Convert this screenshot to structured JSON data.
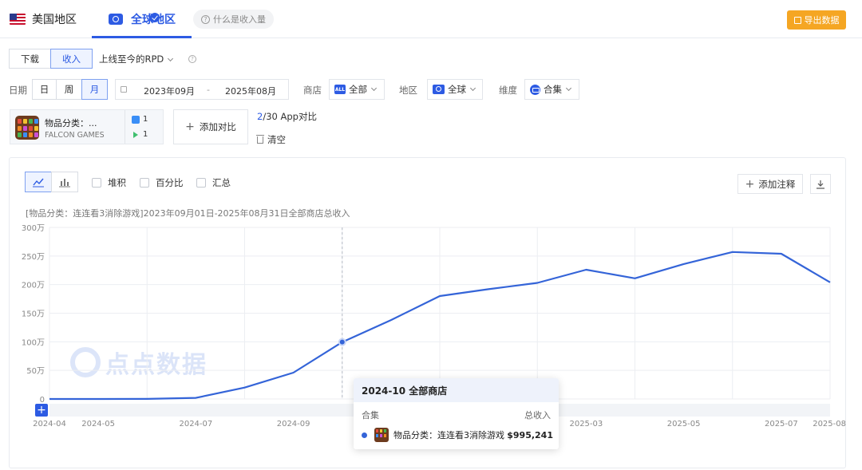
{
  "tabs": {
    "us": "美国地区",
    "global": "全球地区",
    "what_is_revenue": "什么是收入量"
  },
  "export_label": "导出数据",
  "metric": {
    "download": "下载",
    "revenue": "收入",
    "rpd": "上线至今的RPD"
  },
  "filters": {
    "date_label": "日期",
    "day": "日",
    "week": "周",
    "month": "月",
    "date_start": "2023年09月",
    "date_sep": "-",
    "date_end": "2025年08月",
    "store_label": "商店",
    "store_badge": "ALL",
    "store_value": "全部",
    "region_label": "地区",
    "region_value": "全球",
    "dimension_label": "维度",
    "dimension_value": "合集"
  },
  "app": {
    "name": "物品分类：...",
    "developer": "FALCON GAMES",
    "ios_count": "1",
    "android_count": "1"
  },
  "compare": {
    "add_label": "添加对比",
    "count_current": "2",
    "count_rest": "/30 App对比",
    "clear_label": "清空"
  },
  "chart_options": {
    "stack": "堆积",
    "percent": "百分比",
    "summary": "汇总",
    "add_note": "添加注释"
  },
  "chart_caption": "[物品分类：连连看3消除游戏]2023年09月01日-2025年08月31日全部商店总收入",
  "watermark_text": "点点数据",
  "tooltip": {
    "header": "2024-10 全部商店",
    "col_left": "合集",
    "col_right": "总收入",
    "series_label": "物品分类：连连看3消除游戏",
    "value": "$995,241"
  },
  "colors": {
    "accent": "#2d5be3",
    "series": "#3464d8",
    "export": "#f5a623"
  },
  "chart_data": {
    "type": "line",
    "x": [
      "2024-04",
      "2024-05",
      "2024-06",
      "2024-07",
      "2024-08",
      "2024-09",
      "2024-10",
      "2024-11",
      "2024-12",
      "2025-01",
      "2025-02",
      "2025-03",
      "2025-04",
      "2025-05",
      "2025-06",
      "2025-07",
      "2025-08"
    ],
    "x_tick_labels": [
      "2024-04",
      "2024-05",
      "2024-07",
      "2024-09",
      "2025-03",
      "2025-05",
      "2025-07",
      "2025-08"
    ],
    "series": [
      {
        "name": "物品分类：连连看3消除游戏",
        "values": [
          0,
          0,
          1000,
          20000,
          200000,
          460000,
          995241,
          1380000,
          1800000,
          1920000,
          2030000,
          2260000,
          2110000,
          2360000,
          2570000,
          2540000,
          2040000
        ]
      }
    ],
    "y_ticks": [
      "0",
      "50万",
      "100万",
      "150万",
      "200万",
      "250万",
      "300万"
    ],
    "ylim": [
      0,
      3000000
    ],
    "highlight_x": "2024-10",
    "grid": true
  }
}
